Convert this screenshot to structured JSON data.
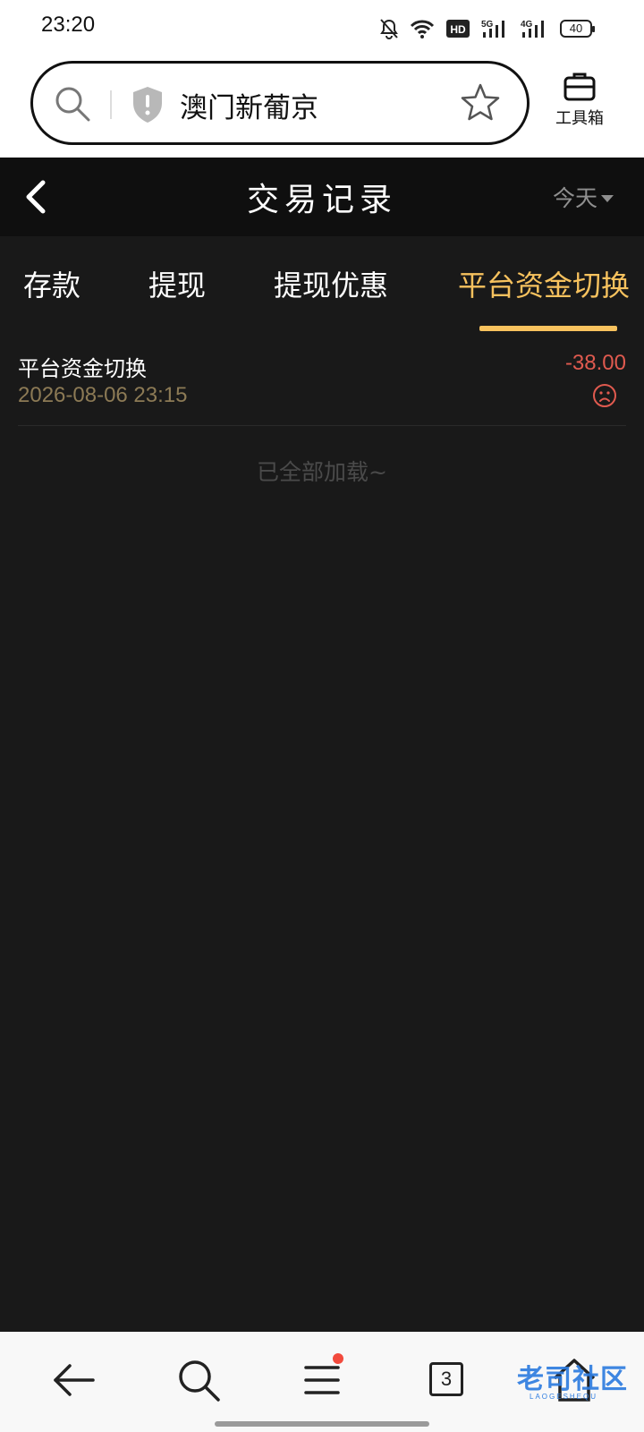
{
  "status_bar": {
    "time": "23:20",
    "battery": "40",
    "icons": [
      "bell-off-icon",
      "wifi-icon",
      "hd-icon",
      "5g-signal-icon",
      "4g-signal-icon",
      "battery-icon"
    ]
  },
  "browser": {
    "url_text": "澳门新葡京",
    "toolbox_label": "工具箱",
    "icons": [
      "search-icon",
      "shield-warning-icon",
      "star-icon",
      "toolbox-icon"
    ]
  },
  "header": {
    "title": "交易记录",
    "date_filter": "今天"
  },
  "tabs": [
    {
      "label": "存款",
      "active": false
    },
    {
      "label": "提现",
      "active": false
    },
    {
      "label": "提现优惠",
      "active": false
    },
    {
      "label": "平台资金切换",
      "active": true
    }
  ],
  "records": [
    {
      "type": "平台资金切换",
      "time": "2026-08-06 23:15",
      "amount": "-38.00",
      "status_icon": "sad-face-icon"
    }
  ],
  "load_end_text": "已全部加载~",
  "bottom_nav": {
    "tab_count": "3",
    "watermark_text": "老司社区",
    "watermark_sub": "LAOGESHEQU"
  },
  "colors": {
    "accent": "#f7c25e",
    "negative": "#e05a4f",
    "background": "#191919"
  }
}
